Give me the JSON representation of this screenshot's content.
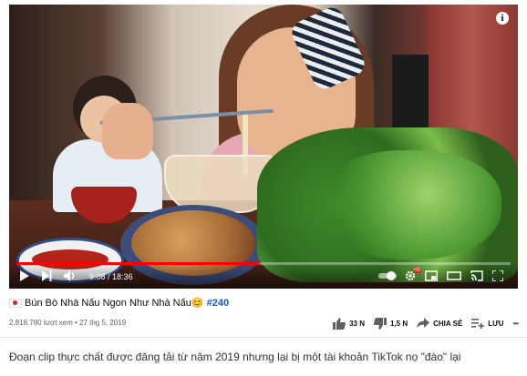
{
  "video": {
    "current_time": "9:08",
    "duration": "18:36",
    "time_separator": " / ",
    "progress": 0.49,
    "info_glyph": "i",
    "hd_badge": "HD"
  },
  "title": {
    "text": "Bún Bò Nhà Nấu Ngon Như Nhà Nấu",
    "emoji": "😊",
    "hashtag": "#240",
    "flag_icon": "japan-flag-icon"
  },
  "meta": {
    "views": "2.818.780 lượt xem",
    "dot": " • ",
    "date": "27 thg 5, 2019"
  },
  "actions": {
    "like_count": "33 N",
    "dislike_count": "1,5 N",
    "share_label": "CHIA SẺ",
    "save_label": "LƯU",
    "more_glyph": "•••"
  },
  "caption": "Đoạn clip thực chất được đăng tải từ năm 2019 nhưng lại bị một tài khoản TikTok nọ \"đào\" lại",
  "colors": {
    "progress": "#ff0000",
    "hashtag": "#065fd4",
    "meta_text": "#606060"
  }
}
